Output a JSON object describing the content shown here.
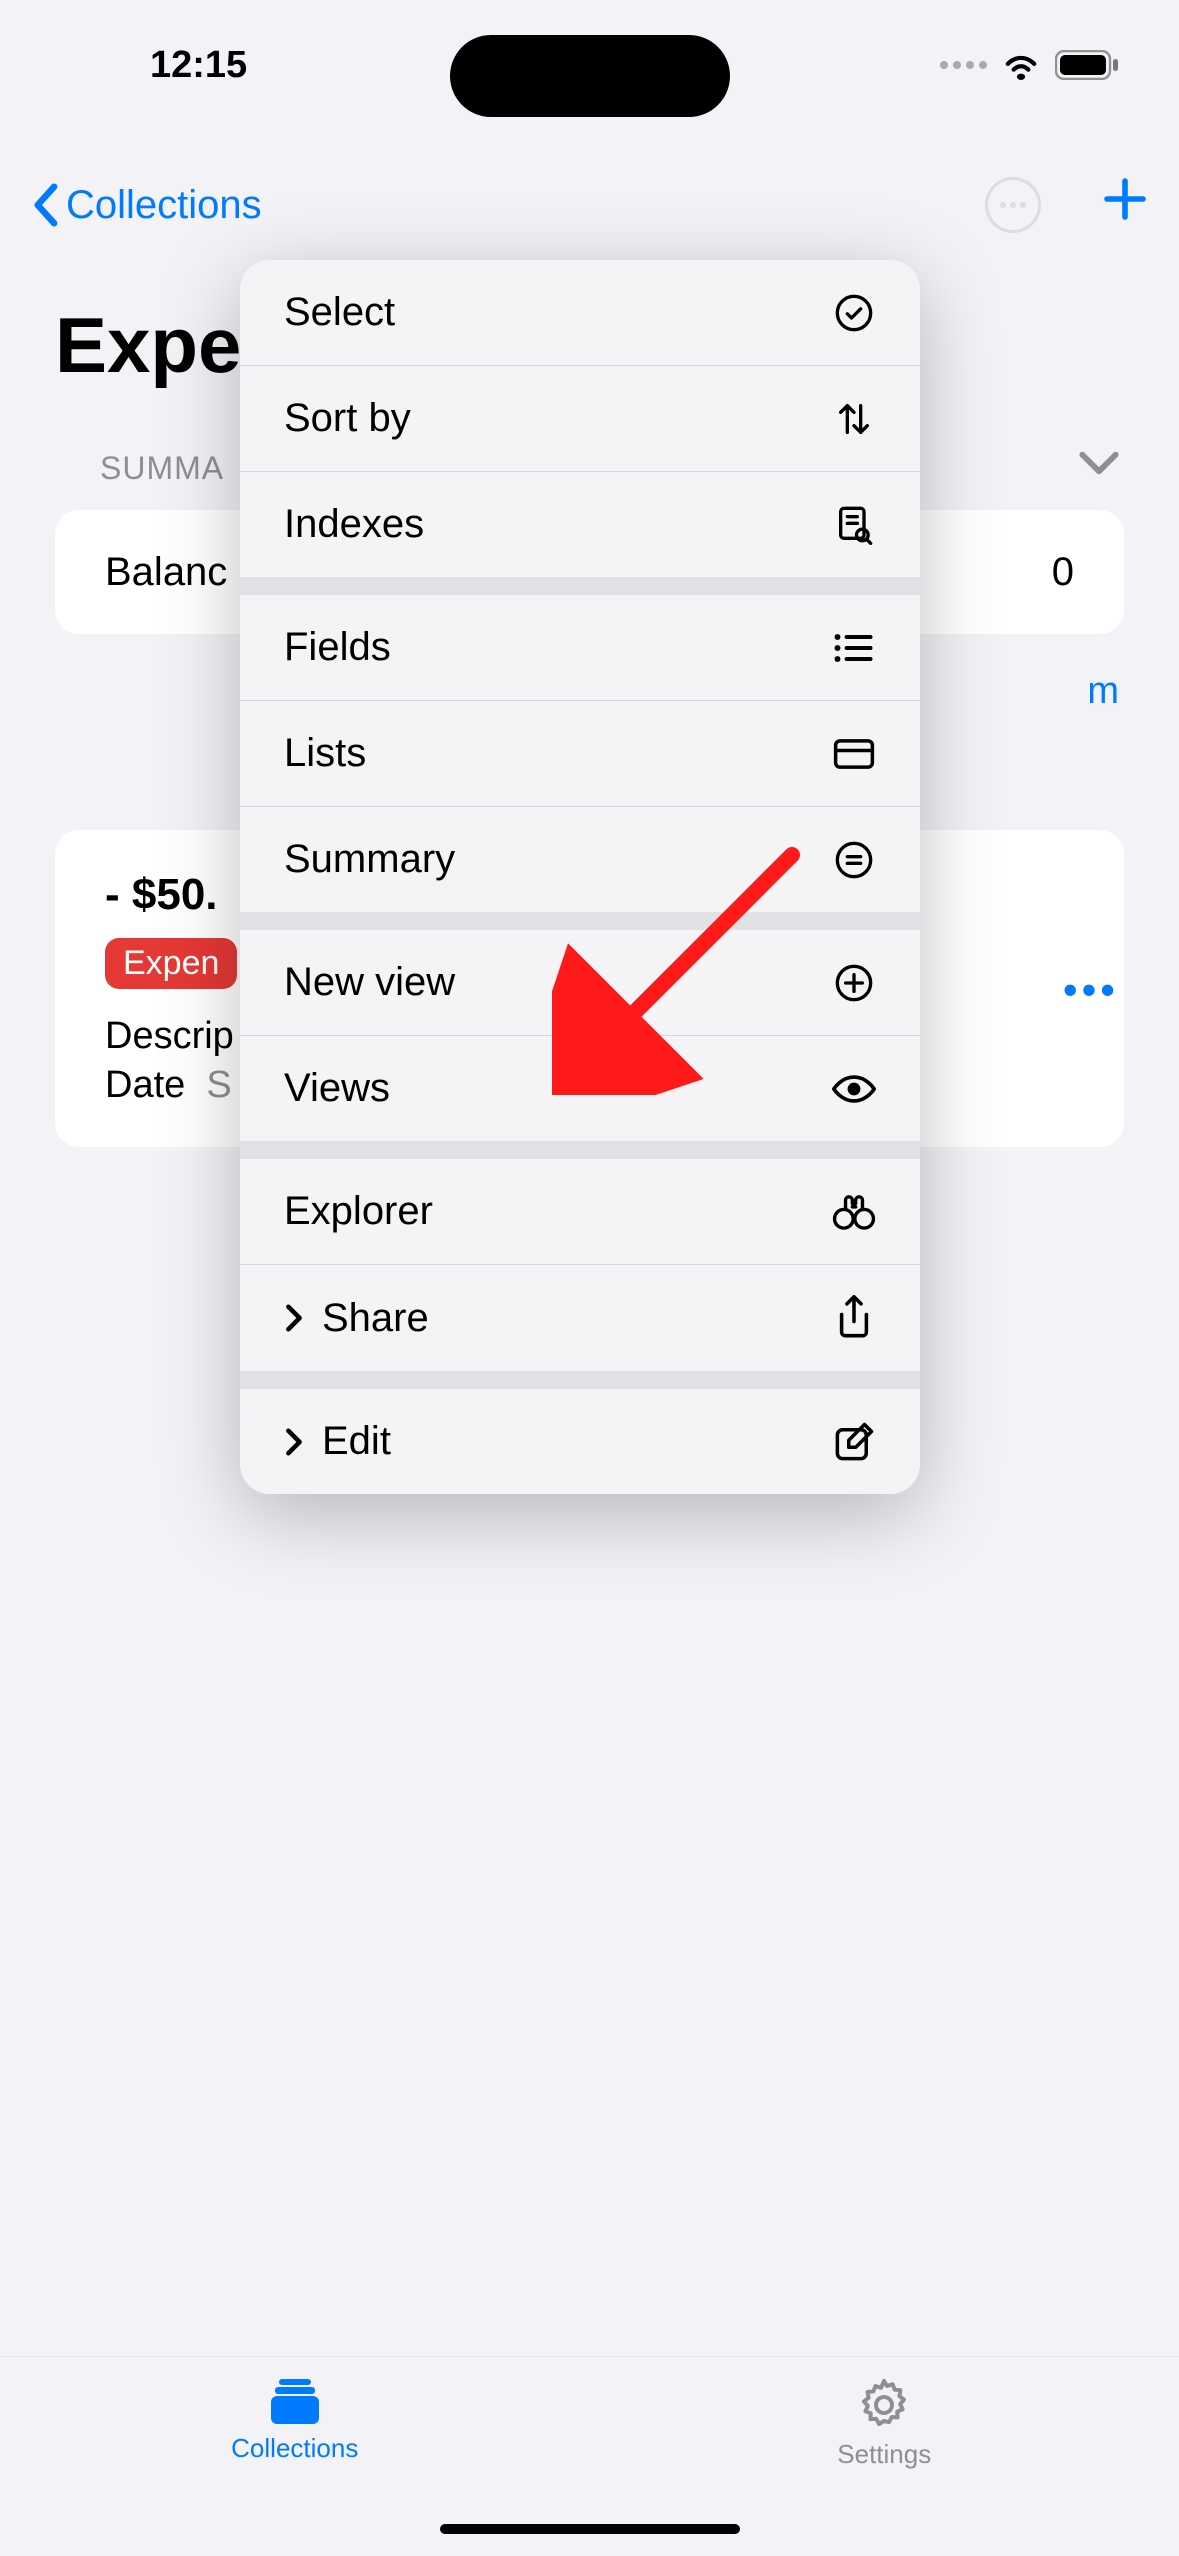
{
  "status": {
    "time": "12:15"
  },
  "nav": {
    "back_label": "Collections"
  },
  "page": {
    "title": "Expe"
  },
  "summary": {
    "header": "SUMMA",
    "balance_label": "Balanc",
    "balance_value_fragment": "0",
    "link_fragment": "m"
  },
  "item": {
    "amount": "- $50.",
    "tag": "Expen",
    "description_label": "Descrip",
    "date_label": "Date",
    "date_value": "S"
  },
  "menu": {
    "group1": [
      {
        "label": "Select",
        "icon": "check-circle"
      },
      {
        "label": "Sort by",
        "icon": "sort-arrows"
      },
      {
        "label": "Indexes",
        "icon": "index-doc"
      }
    ],
    "group2": [
      {
        "label": "Fields",
        "icon": "list-lines"
      },
      {
        "label": "Lists",
        "icon": "card"
      },
      {
        "label": "Summary",
        "icon": "equals-circle"
      }
    ],
    "group3": [
      {
        "label": "New view",
        "icon": "plus-circle"
      },
      {
        "label": "Views",
        "icon": "eye"
      }
    ],
    "group4": [
      {
        "label": "Explorer",
        "icon": "binoculars"
      },
      {
        "label": "Share",
        "icon": "share",
        "submenu": true
      }
    ],
    "group5": [
      {
        "label": "Edit",
        "icon": "pencil-square",
        "submenu": true
      }
    ]
  },
  "tabs": {
    "collections": "Collections",
    "settings": "Settings"
  }
}
